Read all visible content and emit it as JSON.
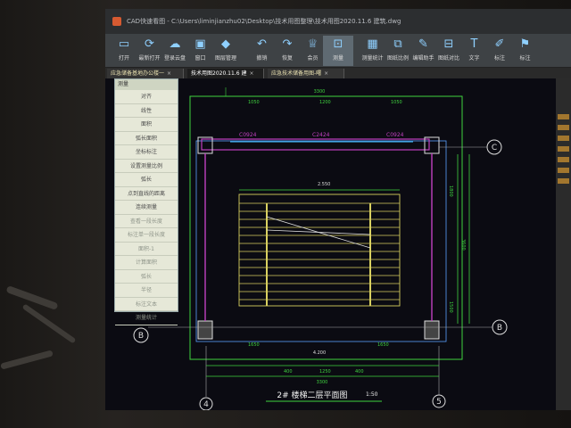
{
  "window": {
    "title": "CAD快速看图 - C:\\Users\\liminjianzhu02\\Desktop\\技术用图整理\\技术用图2020.11.6 建筑.dwg"
  },
  "toolbar": {
    "items": [
      {
        "label": "打开",
        "icon": "folder-open-icon",
        "glyph": "▭"
      },
      {
        "label": "最新打开",
        "icon": "recent-icon",
        "glyph": "⟳"
      },
      {
        "label": "登录云盘",
        "icon": "cloud-icon",
        "glyph": "☁"
      },
      {
        "label": "窗口",
        "icon": "window-icon",
        "glyph": "▣"
      },
      {
        "label": "图层管理",
        "icon": "layers-icon",
        "glyph": "◆"
      },
      {
        "label": "撤销",
        "icon": "undo-icon",
        "glyph": "↶"
      },
      {
        "label": "恢复",
        "icon": "redo-icon",
        "glyph": "↷"
      },
      {
        "label": "会员",
        "icon": "vip-icon",
        "glyph": "♕"
      },
      {
        "label": "测量",
        "icon": "measure-icon",
        "glyph": "⊡"
      },
      {
        "label": "测量统计",
        "icon": "measure-stats-icon",
        "glyph": "▦"
      },
      {
        "label": "图纸比例",
        "icon": "scale-icon",
        "glyph": "⧉"
      },
      {
        "label": "编辑助手",
        "icon": "edit-helper-icon",
        "glyph": "✎"
      },
      {
        "label": "图纸对比",
        "icon": "compare-icon",
        "glyph": "⊟"
      },
      {
        "label": "文字",
        "icon": "text-icon",
        "glyph": "T"
      },
      {
        "label": "标注",
        "icon": "annotate-icon",
        "glyph": "✐"
      },
      {
        "label": "标注",
        "icon": "mark-icon",
        "glyph": "⚑"
      }
    ],
    "active_index": 8
  },
  "tabs": [
    {
      "label": "应急储备基地办公楼一",
      "active": false
    },
    {
      "label": "技术用图2020.11.6 建",
      "active": true
    },
    {
      "label": "应急技术储备用图-曙",
      "active": false
    }
  ],
  "measure_panel": {
    "header": "测量",
    "items": [
      {
        "label": "对齐",
        "dim": false
      },
      {
        "label": "线性",
        "dim": false
      },
      {
        "label": "面积",
        "dim": false
      },
      {
        "label": "弧长面积",
        "dim": false
      },
      {
        "label": "坐标标注",
        "dim": false
      },
      {
        "label": "设置测量比例",
        "dim": false
      },
      {
        "label": "弧长",
        "dim": false
      },
      {
        "label": "点到直线的距离",
        "dim": false
      },
      {
        "label": "连续测量",
        "dim": false
      },
      {
        "label": "查看一段长度",
        "dim": true
      },
      {
        "label": "标注单一段长度",
        "dim": true
      },
      {
        "label": "面积-1",
        "dim": true
      },
      {
        "label": "计算面积",
        "dim": true
      },
      {
        "label": "弧长",
        "dim": true
      },
      {
        "label": "半径",
        "dim": true
      },
      {
        "label": "标注文本",
        "dim": true
      },
      {
        "label": "测量统计",
        "dim": true
      }
    ]
  },
  "drawing": {
    "title": "2# 楼梯二层平面图",
    "scale": "1:50",
    "window_labels": [
      "C0924",
      "C2424",
      "C0924"
    ],
    "axis_labels": {
      "c": "C",
      "b": "B",
      "four": "4",
      "five": "5"
    },
    "top_dim_total": "3300",
    "top_dims": [
      "1050",
      "1200",
      "1050"
    ],
    "bottom_dim_total": "3300",
    "bottom_dims": [
      "400",
      "1250",
      "400"
    ],
    "right_dims": [
      "1800",
      "3600",
      "1500"
    ],
    "stair_label": "2.550",
    "landing_label": "4.200",
    "small_labels": [
      "1650",
      "1650",
      "120"
    ]
  },
  "colors": {
    "cad_bg": "#0b0b12",
    "grid_green": "#3fd33f",
    "wall_magenta": "#c040c0",
    "stair_yellow": "#d8d060",
    "axis_blue": "#5aa0ff"
  }
}
